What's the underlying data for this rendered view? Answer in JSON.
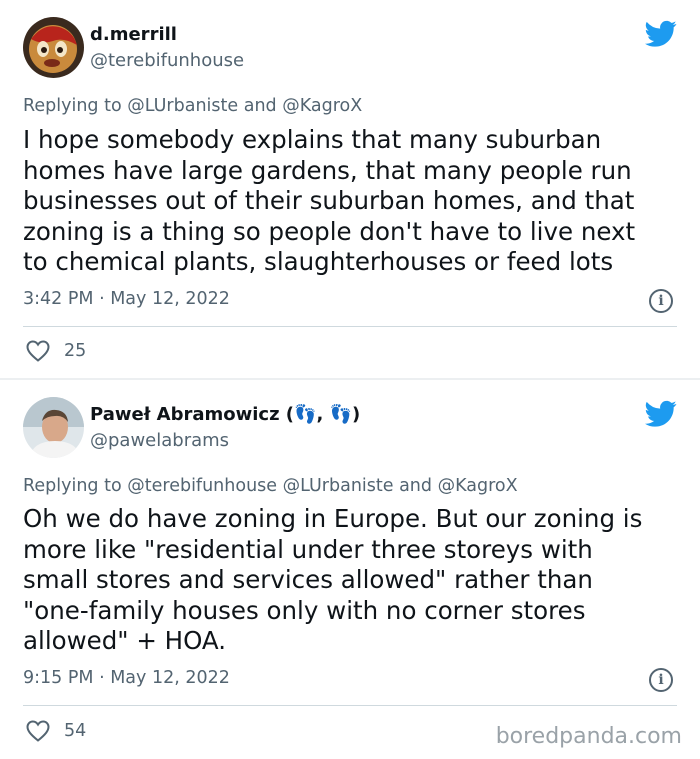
{
  "tweets": [
    {
      "name": "d.merrill",
      "handle": "@terebifunhouse",
      "replying_prefix": "Replying to",
      "replying_handles": "@LUrbaniste and @KagroX",
      "text": "I hope somebody explains that many suburban\nhomes have large gardens, that many people run\nbusinesses out of their suburban homes, and that\nzoning is a thing so people don't have to live next\nto chemical plants, slaughterhouses or feed lots",
      "time": "3:42 PM · May 12, 2022",
      "likes": "25"
    },
    {
      "name": "Paweł Abramowicz (👣, 👣)",
      "handle": "@pawelabrams",
      "replying_prefix": "Replying to",
      "replying_handles": "@terebifunhouse @LUrbaniste and @KagroX",
      "text": "Oh we do have zoning in Europe. But our zoning is\nmore like \"residential under three storeys with\nsmall stores and services allowed\" rather than\n\"one-family houses only with no corner stores\nallowed\" + HOA.",
      "time": "9:15 PM · May 12, 2022",
      "likes": "54"
    }
  ],
  "info_glyph": "i",
  "watermark": "boredpanda.com",
  "colors": {
    "twitter_blue": "#1d9bf0",
    "secondary_text": "#536471"
  }
}
